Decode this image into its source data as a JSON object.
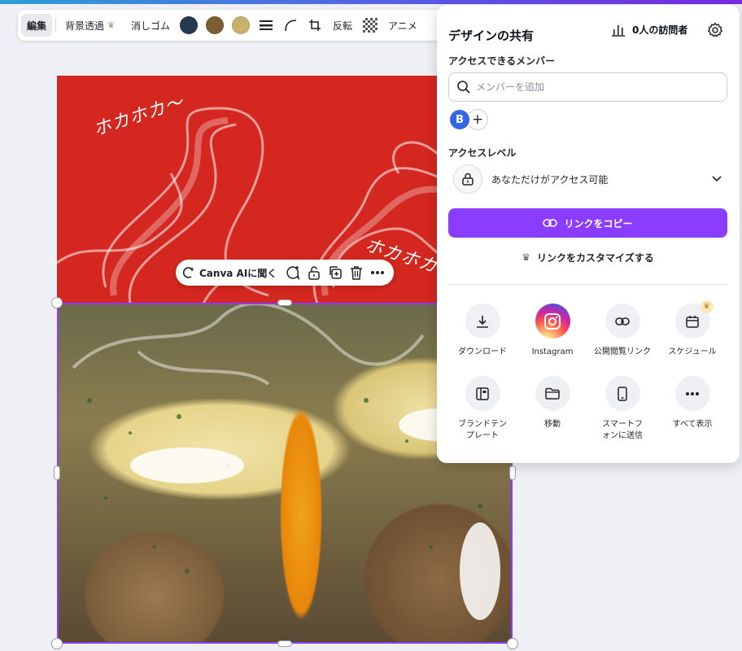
{
  "toolbar": {
    "edit_label": "編集",
    "bg_remove_label": "背景透過",
    "eraser_label": "消しゴム",
    "swatches": [
      "#243a52",
      "#7b5e34",
      "#c7b26a"
    ],
    "flip_label": "反転",
    "animate_label": "アニメ"
  },
  "design": {
    "text_1": "ホカホカ〜",
    "text_2": "ホカホカ",
    "bg_color": "#d3271f"
  },
  "context_toolbar": {
    "ai_label": "Canva AIに聞く"
  },
  "share_panel": {
    "title": "デザインの共有",
    "visitors_label": "0人の訪問者",
    "members_heading": "アクセスできるメンバー",
    "search_placeholder": "メンバーを追加",
    "avatar_initial": "B",
    "add_symbol": "+",
    "access_level_heading": "アクセスレベル",
    "access_level_value": "あなただけがアクセス可能",
    "copy_link_label": "リンクをコピー",
    "customize_link_label": "リンクをカスタマイズする",
    "accent_color": "#8b3dff",
    "options": [
      {
        "label": "ダウンロード",
        "icon": "download-icon"
      },
      {
        "label": "Instagram",
        "icon": "instagram-icon"
      },
      {
        "label": "公開閲覧リンク",
        "icon": "link-icon"
      },
      {
        "label": "スケジュール",
        "icon": "calendar-icon"
      },
      {
        "label": "ブランドテンプレート",
        "icon": "brand-template-icon"
      },
      {
        "label": "移動",
        "icon": "folder-icon"
      },
      {
        "label": "スマートフォンに送信",
        "icon": "smartphone-icon"
      },
      {
        "label": "すべて表示",
        "icon": "more-icon"
      }
    ]
  }
}
